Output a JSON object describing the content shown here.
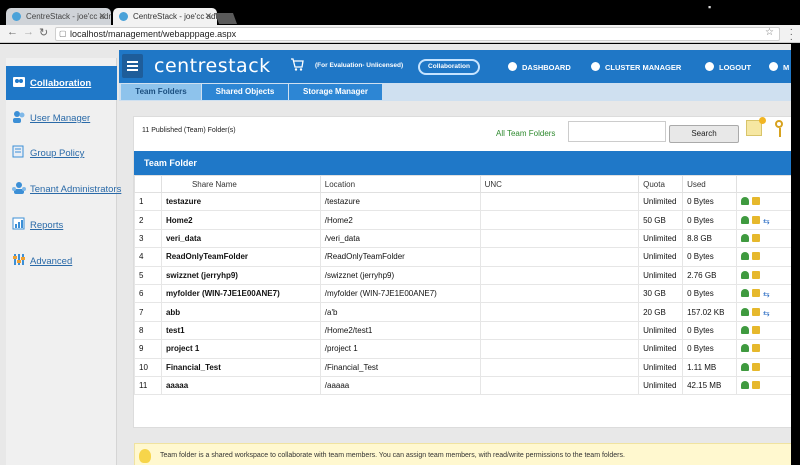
{
  "browser": {
    "tabs": [
      {
        "title": "CentreStack - joe'cc admi",
        "active": false
      },
      {
        "title": "CentreStack - joe'cc admi",
        "active": true
      }
    ],
    "url": "localhost/management/webapppage.aspx"
  },
  "header": {
    "brand": "centrestack",
    "evaluation": "(For Evaluation- Unlicensed)",
    "collaboration_pill": "Collaboration",
    "nav": [
      {
        "label": "DASHBOARD",
        "icon": "dashboard-icon"
      },
      {
        "label": "CLUSTER MANAGER",
        "icon": "cluster-icon"
      },
      {
        "label": "LOGOUT",
        "icon": "power-icon"
      },
      {
        "label": "M",
        "icon": "menu-icon"
      }
    ]
  },
  "sidebar": {
    "items": [
      {
        "label": "Collaboration",
        "icon": "collaboration-icon",
        "active": true
      },
      {
        "label": "User Manager",
        "icon": "users-icon",
        "active": false
      },
      {
        "label": "Group Policy",
        "icon": "policy-icon",
        "active": false
      },
      {
        "label": "Tenant Administrators",
        "icon": "admins-icon",
        "active": false
      },
      {
        "label": "Reports",
        "icon": "reports-icon",
        "active": false
      },
      {
        "label": "Advanced",
        "icon": "advanced-icon",
        "active": false
      }
    ]
  },
  "subtabs": [
    {
      "label": "Team Folders",
      "active": true
    },
    {
      "label": "Shared Objects",
      "active": false
    },
    {
      "label": "Storage Manager",
      "active": false
    }
  ],
  "panel": {
    "published_count": "11 Published (Team) Folder(s)",
    "all_folders": "All Team Folders",
    "search_value": "",
    "search_button": "Search",
    "section_title": "Team Folder"
  },
  "table": {
    "columns": [
      "",
      "Share Name",
      "Location",
      "UNC",
      "Quota",
      "Used",
      ""
    ],
    "rows": [
      {
        "n": "1",
        "name": "testazure",
        "location": "/testazure",
        "unc": "",
        "quota": "Unlimited",
        "used": "0 Bytes",
        "sync": false
      },
      {
        "n": "2",
        "name": "Home2",
        "location": "/Home2",
        "unc": "",
        "quota": "50 GB",
        "used": "0 Bytes",
        "sync": true
      },
      {
        "n": "3",
        "name": "veri_data",
        "location": "/veri_data",
        "unc": "",
        "quota": "Unlimited",
        "used": "8.8 GB",
        "sync": false
      },
      {
        "n": "4",
        "name": "ReadOnlyTeamFolder",
        "location": "/ReadOnlyTeamFolder",
        "unc": "",
        "quota": "Unlimited",
        "used": "0 Bytes",
        "sync": false
      },
      {
        "n": "5",
        "name": "swizznet (jerryhp9)",
        "location": "/swizznet (jerryhp9)",
        "unc": "",
        "quota": "Unlimited",
        "used": "2.76 GB",
        "sync": false
      },
      {
        "n": "6",
        "name": "myfolder (WIN-7JE1E00ANE7)",
        "location": "/myfolder (WIN-7JE1E00ANE7)",
        "unc": "",
        "quota": "30 GB",
        "used": "0 Bytes",
        "sync": true
      },
      {
        "n": "7",
        "name": "abb",
        "location": "/a'b",
        "unc": "",
        "quota": "20 GB",
        "used": "157.02 KB",
        "sync": true
      },
      {
        "n": "8",
        "name": "test1",
        "location": "/Home2/test1",
        "unc": "",
        "quota": "Unlimited",
        "used": "0 Bytes",
        "sync": false
      },
      {
        "n": "9",
        "name": "project 1",
        "location": "/project 1",
        "unc": "",
        "quota": "Unlimited",
        "used": "0 Bytes",
        "sync": false
      },
      {
        "n": "10",
        "name": "Financial_Test",
        "location": "/Financial_Test",
        "unc": "",
        "quota": "Unlimited",
        "used": "1.11 MB",
        "sync": false
      },
      {
        "n": "11",
        "name": "aaaaa",
        "location": "/aaaaa",
        "unc": "",
        "quota": "Unlimited",
        "used": "42.15 MB",
        "sync": false
      }
    ]
  },
  "tip": "Team folder is a shared workspace to collaborate with team members. You can assign team members, with read/write permissions to the team folders."
}
